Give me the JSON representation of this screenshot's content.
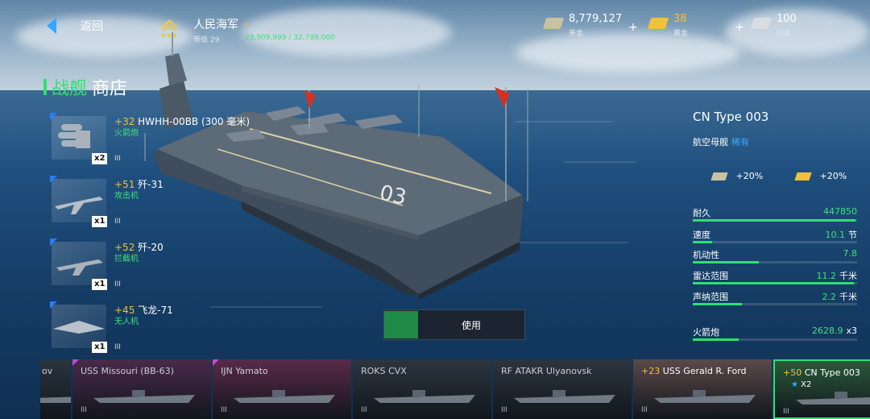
{
  "topbar": {
    "back_label": "返回",
    "player_name": "人民海军",
    "level": "等级 29",
    "xp": "29,909,999 / 32,799,000"
  },
  "currencies": [
    {
      "value": "8,779,127",
      "label": "美金",
      "color": "#c9c2a0"
    },
    {
      "value": "38",
      "label": "黄金",
      "color": "#f2c03a"
    },
    {
      "value": "100",
      "label": "白金",
      "color": "#d8dde2"
    }
  ],
  "title": {
    "category": "战舰",
    "shop": "商店"
  },
  "items": [
    {
      "bonus": "+32",
      "name": "HWHH-00BB (300 毫米)",
      "type": "火箭炮",
      "qty": "x2",
      "tier": "III"
    },
    {
      "bonus": "+51",
      "name": "歼-31",
      "type": "攻击机",
      "qty": "x1",
      "tier": "III"
    },
    {
      "bonus": "+52",
      "name": "歼-20",
      "type": "拦截机",
      "qty": "x1",
      "tier": "III"
    },
    {
      "bonus": "+45",
      "name": "飞龙-71",
      "type": "无人机",
      "qty": "x1",
      "tier": "III"
    }
  ],
  "use_button": "使用",
  "ship": {
    "name": "CN Type 003",
    "class": "航空母舰",
    "rarity": "稀有",
    "bonus_silver": "+20%",
    "bonus_gold": "+20%"
  },
  "stats": [
    {
      "label": "耐久",
      "value": "447850",
      "unit": "",
      "level": 0.99
    },
    {
      "label": "速度",
      "value": "10.1",
      "unit": "节",
      "level": 0.12
    },
    {
      "label": "机动性",
      "value": "7.8",
      "unit": "",
      "level": 0.4
    },
    {
      "label": "雷达范围",
      "value": "11.2",
      "unit": "千米",
      "level": 0.98
    },
    {
      "label": "声纳范围",
      "value": "2.2",
      "unit": "千米",
      "level": 0.3
    },
    {
      "label": "火箭炮",
      "value": "2628.9",
      "unit": "x3",
      "level": 0.28
    }
  ],
  "carousel": [
    {
      "label": "ov",
      "bonus": "",
      "tier": "",
      "accent": "#2a3540"
    },
    {
      "label": "USS Missouri (BB-63)",
      "bonus": "",
      "tier": "III",
      "accent": "#4a2a4a"
    },
    {
      "label": "IJN Yamato",
      "bonus": "",
      "tier": "III",
      "accent": "#5a2a4a"
    },
    {
      "label": "ROKS CVX",
      "bonus": "",
      "tier": "III",
      "accent": "#2c3640"
    },
    {
      "label": "RF ATAKR Ulyanovsk",
      "bonus": "",
      "tier": "III",
      "accent": "#2c3640"
    },
    {
      "label": "USS Gerald R. Ford",
      "bonus": "+23",
      "tier": "III",
      "accent": "#5a4a4a"
    },
    {
      "label": "CN Type 003",
      "bonus": "+50",
      "tier": "III",
      "accent": "#2a5a3a",
      "selected_badge": "X2"
    }
  ],
  "colors": {
    "accent_green": "#2ee06e",
    "accent_blue": "#3aa7ff",
    "gold": "#f2c03a"
  }
}
